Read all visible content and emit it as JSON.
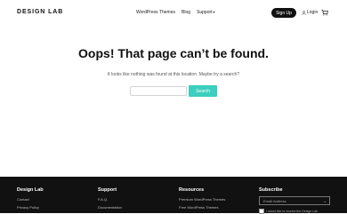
{
  "header": {
    "logo": "DESIGN LAB",
    "nav": [
      "WordPress Themes",
      "Blog",
      "Support"
    ],
    "signup_label": "Sign Up",
    "login_label": "Login"
  },
  "main": {
    "title": "Oops! That page can’t be found.",
    "subtitle": "It looks like nothing was found at this location. Maybe try a search?",
    "search_placeholder": "",
    "search_button": "Search"
  },
  "footer": {
    "col1": {
      "heading": "Design Lab",
      "links": [
        "Contact",
        "Privacy Policy"
      ]
    },
    "col2": {
      "heading": "Support",
      "links": [
        "F.A.Q.",
        "Documentation"
      ]
    },
    "col3": {
      "heading": "Resources",
      "links": [
        "Premium WordPress Themes",
        "Free WordPress Themes"
      ]
    },
    "subscribe": {
      "heading": "Subscribe",
      "email_placeholder": "Email Address",
      "consent_text": "I would like to receive the Design Lab"
    }
  },
  "colors": {
    "accent": "#3ccfbf",
    "dark": "#111111"
  }
}
